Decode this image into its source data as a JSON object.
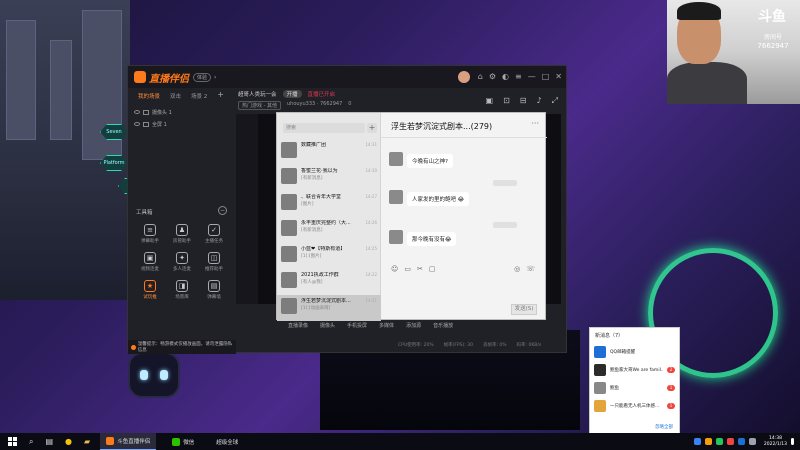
{
  "webcam": {
    "logo": "斗鱼",
    "id_line": "房间号",
    "room_number": "7662947"
  },
  "app": {
    "name": "直播伴侣",
    "version": "体验",
    "left_tabs": [
      "我的场景",
      "双击",
      "场景 2"
    ],
    "scenes": [
      "摄像头 1",
      "全屏 1"
    ],
    "tools_label": "工具箱",
    "tools": [
      {
        "label": "弹幕助手",
        "icon": "≡",
        "hot": false
      },
      {
        "label": "房管助手",
        "icon": "♟",
        "hot": false
      },
      {
        "label": "主播任务",
        "icon": "✓",
        "hot": false
      },
      {
        "label": "视频连麦",
        "icon": "▣",
        "hot": false
      },
      {
        "label": "多人连麦",
        "icon": "✦",
        "hot": false
      },
      {
        "label": "推荐助手",
        "icon": "◫",
        "hot": false
      },
      {
        "label": "试玩推",
        "icon": "★",
        "hot": true
      },
      {
        "label": "场景库",
        "icon": "◨",
        "hot": false
      },
      {
        "label": "弹幕墙",
        "icon": "▤",
        "hot": false
      }
    ],
    "center_title": "超哥人类玩一会",
    "center_tag1": "开播",
    "center_tag2": "直播已开启",
    "center_sub": [
      "热门游戏 - 其他",
      "uhouyu333 · 7662947",
      "0"
    ],
    "bottom_tools": [
      "直播录像",
      "摄像头",
      "手机投屏",
      "多媒体",
      "添加源",
      "音乐播放"
    ],
    "stats": [
      "CPU使用率: 20%",
      "帧率(FPS): 30",
      "丢帧率: 0%",
      "码率: 0KB/s"
    ],
    "notice": "温馨提示：畅游模式仅播放画面，请勿泄露隐私信息"
  },
  "chat": {
    "search_placeholder": "搜索",
    "title": "浮生若梦沉淀式剧本...(279)",
    "conversations": [
      {
        "name": "数藏推广团",
        "preview": "",
        "time": "14:31"
      },
      {
        "name": "香蜜兰花·我以为",
        "preview": "[有新消息]",
        "time": "14:30"
      },
      {
        "name": "、联合青年大学堂",
        "preview": "[图片]",
        "time": "14:27"
      },
      {
        "name": "永丰重庆完整约（大...",
        "preview": "[有新消息]",
        "time": "14:26"
      },
      {
        "name": "小蓝❤【特斯有道】",
        "preview": "[1]:[图片]",
        "time": "14:25"
      },
      {
        "name": "2021执政工作群",
        "preview": "[有人@我]",
        "time": "14:22"
      },
      {
        "name": "浮生若梦沉淀式剧本...",
        "preview": "[1]:[动画表情]",
        "time": "14:21"
      }
    ],
    "messages": [
      {
        "text": "今晚有山之神?"
      },
      {
        "text": "人家发的里的鲍吧 😂"
      },
      {
        "text": "那今晚有没有😂"
      }
    ],
    "send": "发送(S)"
  },
  "qq": {
    "header": "新消息（7）",
    "rows": [
      {
        "text": "QQ邮箱提醒",
        "badge": "",
        "color": "#1d6fd6"
      },
      {
        "text": "鲍鱼家大哥We are famil...",
        "badge": "2",
        "color": "#2b2b2b"
      },
      {
        "text": "鲍鱼",
        "badge": "1",
        "color": "#888888"
      },
      {
        "text": "一只能看无人机三体感...",
        "badge": "1",
        "color": "#e3a43a"
      }
    ],
    "footer": "忽略全部"
  },
  "taskbar": {
    "items": [
      "斗鱼直播伴侣",
      "微信",
      "超级全球"
    ],
    "clock_time": "14:38",
    "clock_date": "2022/1/13"
  }
}
